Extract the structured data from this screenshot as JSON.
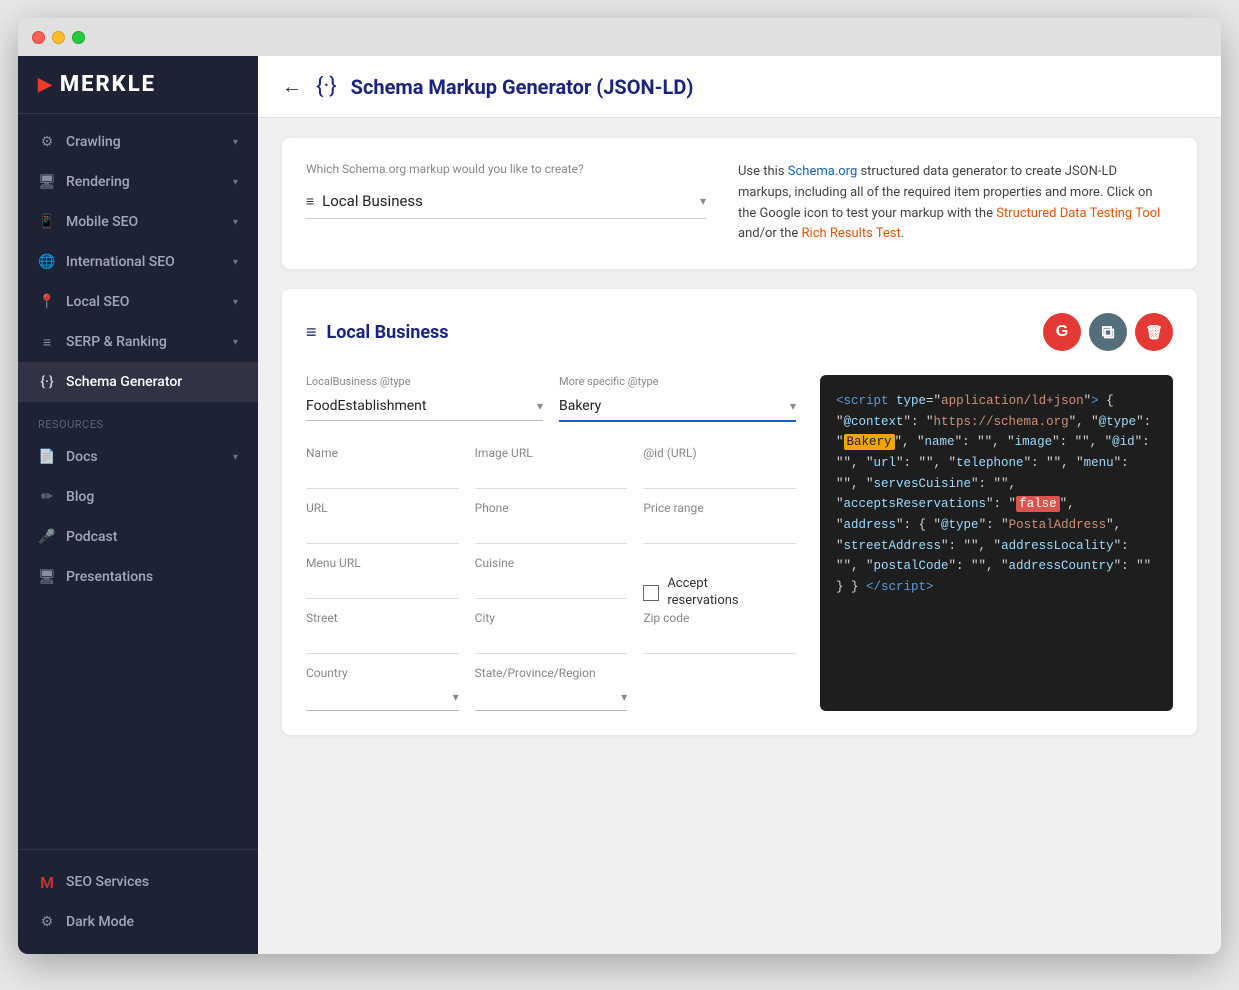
{
  "window": {
    "title": "Schema Markup Generator (JSON-LD)"
  },
  "sidebar": {
    "logo": "MERKLE",
    "nav_items": [
      {
        "id": "crawling",
        "label": "Crawling",
        "icon": "⚙",
        "has_chevron": true,
        "active": false
      },
      {
        "id": "rendering",
        "label": "Rendering",
        "icon": "🖥",
        "has_chevron": true,
        "active": false
      },
      {
        "id": "mobile-seo",
        "label": "Mobile SEO",
        "icon": "📱",
        "has_chevron": true,
        "active": false
      },
      {
        "id": "international-seo",
        "label": "International SEO",
        "icon": "🌐",
        "has_chevron": true,
        "active": false
      },
      {
        "id": "local-seo",
        "label": "Local SEO",
        "icon": "📍",
        "has_chevron": true,
        "active": false
      },
      {
        "id": "serp-ranking",
        "label": "SERP & Ranking",
        "icon": "≡",
        "has_chevron": true,
        "active": false
      },
      {
        "id": "schema-generator",
        "label": "Schema Generator",
        "icon": "{.}",
        "has_chevron": false,
        "active": true
      }
    ],
    "resources_label": "Resources",
    "resource_items": [
      {
        "id": "docs",
        "label": "Docs",
        "icon": "📄",
        "has_chevron": true
      },
      {
        "id": "blog",
        "label": "Blog",
        "icon": "✏",
        "has_chevron": false
      },
      {
        "id": "podcast",
        "label": "Podcast",
        "icon": "🎤",
        "has_chevron": false
      },
      {
        "id": "presentations",
        "label": "Presentations",
        "icon": "🖥",
        "has_chevron": false
      }
    ],
    "bottom_items": [
      {
        "id": "seo-services",
        "label": "SEO Services",
        "icon": "M"
      },
      {
        "id": "dark-mode",
        "label": "Dark Mode",
        "icon": "⚙"
      }
    ]
  },
  "header": {
    "back_icon": "←",
    "schema_icon": "{·}",
    "title": "Schema Markup Generator (JSON-LD)"
  },
  "info_card": {
    "select_label": "Which Schema.org markup would you like to create?",
    "selected_schema": "Local Business",
    "description_parts": [
      {
        "type": "text",
        "value": "Use this "
      },
      {
        "type": "link",
        "value": "Schema.org",
        "color": "blue"
      },
      {
        "type": "text",
        "value": " structured data generator to create JSON-LD markups, including all of the required item properties and more. Click on the Google icon to test your markup with the "
      },
      {
        "type": "link",
        "value": "Structured Data Testing Tool",
        "color": "orange"
      },
      {
        "type": "text",
        "value": " and/or the "
      },
      {
        "type": "link",
        "value": "Rich Results Test",
        "color": "orange"
      },
      {
        "type": "text",
        "value": "."
      }
    ]
  },
  "form_card": {
    "title": "Local Business",
    "title_icon": "≡",
    "google_btn_label": "G",
    "copy_btn_label": "⧉",
    "delete_btn_label": "🗑",
    "type_field": {
      "label": "LocalBusiness @type",
      "value": "FoodEstablishment"
    },
    "specific_type_field": {
      "label": "More specific @type",
      "value": "Bakery"
    },
    "fields": [
      {
        "id": "name",
        "label": "Name",
        "col": 1,
        "row": 1
      },
      {
        "id": "image",
        "label": "Image URL",
        "col": 2,
        "row": 1
      },
      {
        "id": "id-url",
        "label": "@id (URL)",
        "col": 3,
        "row": 1
      },
      {
        "id": "url",
        "label": "URL",
        "col": 1,
        "row": 2
      },
      {
        "id": "phone",
        "label": "Phone",
        "col": 2,
        "row": 2
      },
      {
        "id": "price-range",
        "label": "Price range",
        "col": 3,
        "row": 2
      },
      {
        "id": "menu-url",
        "label": "Menu URL",
        "col": 1,
        "row": 3
      },
      {
        "id": "cuisine",
        "label": "Cuisine",
        "col": 2,
        "row": 3
      },
      {
        "id": "accept-reservations",
        "label": "Accept reservations",
        "col": 3,
        "row": 3,
        "type": "checkbox"
      },
      {
        "id": "street",
        "label": "Street",
        "col": 1,
        "row": 4
      },
      {
        "id": "city",
        "label": "City",
        "col": 2,
        "row": 4
      },
      {
        "id": "zip",
        "label": "Zip code",
        "col": 3,
        "row": 4
      },
      {
        "id": "country",
        "label": "Country",
        "col": 1,
        "row": 5,
        "type": "select"
      },
      {
        "id": "state",
        "label": "State/Province/Region",
        "col": 2,
        "row": 5,
        "type": "select"
      }
    ]
  },
  "code": {
    "context": "https://schema.org",
    "type": "Bakery",
    "name_val": "",
    "image_val": "",
    "id_val": "",
    "url_val": "",
    "telephone_val": "",
    "menu_val": "",
    "servesCuisine_val": "",
    "acceptsReservations_val": "false",
    "address_type": "PostalAddress",
    "streetAddress_val": "",
    "addressLocality_val": "",
    "postalCode_val": "",
    "addressCountry_val": ""
  }
}
